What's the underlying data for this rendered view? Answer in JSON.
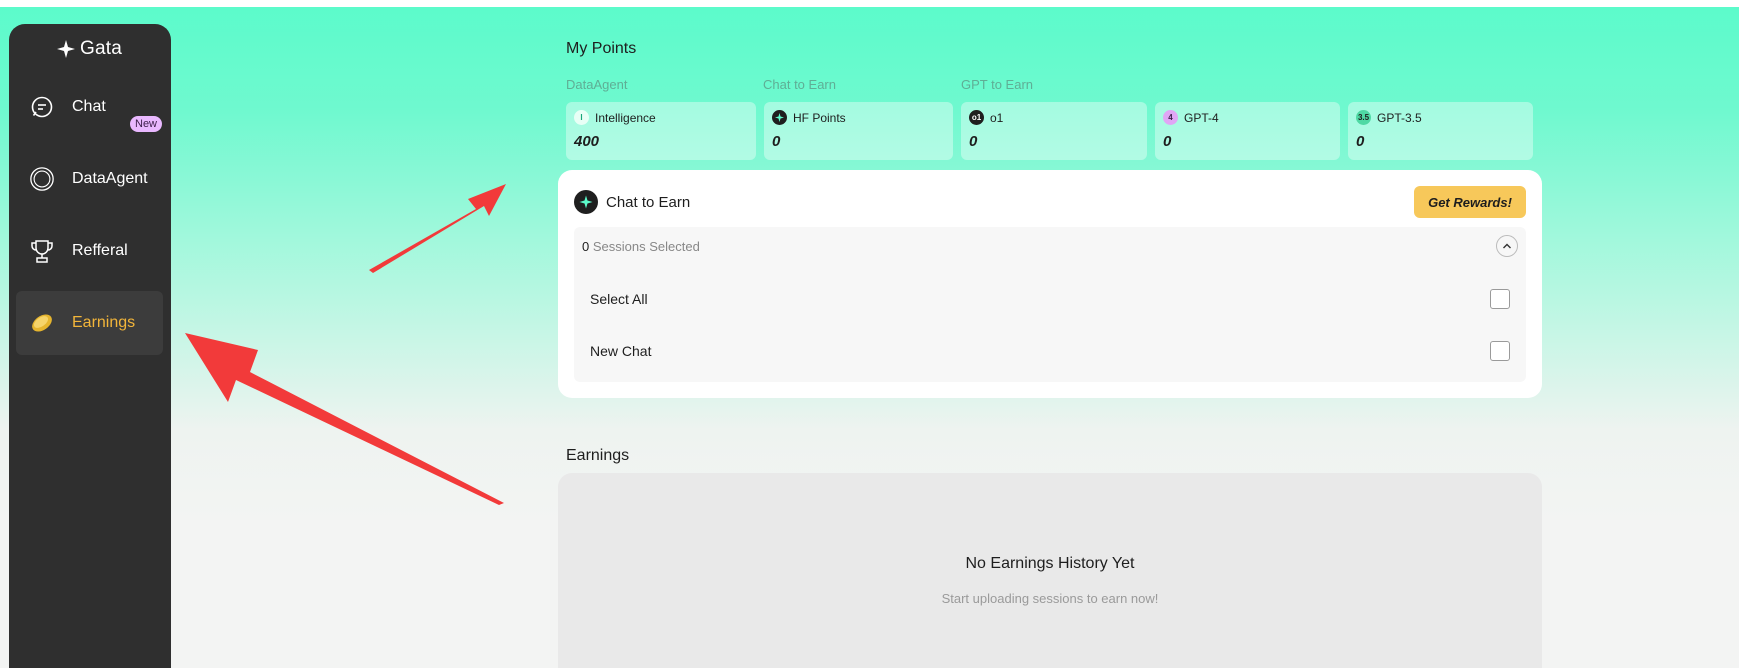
{
  "app": {
    "logo_text": "Gata"
  },
  "sidebar": {
    "items": [
      {
        "label": "Chat",
        "icon": "chat-icon"
      },
      {
        "label": "DataAgent",
        "icon": "dataagent-icon",
        "badge": "New"
      },
      {
        "label": "Refferal",
        "icon": "trophy-icon"
      },
      {
        "label": "Earnings",
        "icon": "coin-icon",
        "active": true
      }
    ]
  },
  "points": {
    "title": "My Points",
    "groups": [
      "DataAgent",
      "Chat to Earn",
      "GPT to Earn"
    ],
    "cards": [
      {
        "label": "Intelligence",
        "value": "400",
        "icon": "intelligence-icon"
      },
      {
        "label": "HF Points",
        "value": "0",
        "icon": "hf-bolt-icon"
      },
      {
        "label": "o1",
        "value": "0",
        "icon": "o1-icon"
      },
      {
        "label": "GPT-4",
        "value": "0",
        "icon": "gpt4-icon"
      },
      {
        "label": "GPT-3.5",
        "value": "0",
        "icon": "gpt35-icon"
      }
    ]
  },
  "chat_to_earn": {
    "title": "Chat to Earn",
    "rewards_button": "Get Rewards!",
    "sessions_count": "0",
    "sessions_label": "Sessions Selected",
    "rows": [
      "Select All",
      "New Chat"
    ]
  },
  "earnings": {
    "title": "Earnings",
    "empty_title": "No Earnings History Yet",
    "empty_subtitle": "Start uploading sessions to earn now!"
  },
  "colors": {
    "sidebar_bg": "#2f2f2f",
    "active_label": "#f2b53a",
    "mint": "#5cfbcb",
    "rewards_btn": "#f7c85a",
    "annotation_arrow": "#f23a3a"
  }
}
